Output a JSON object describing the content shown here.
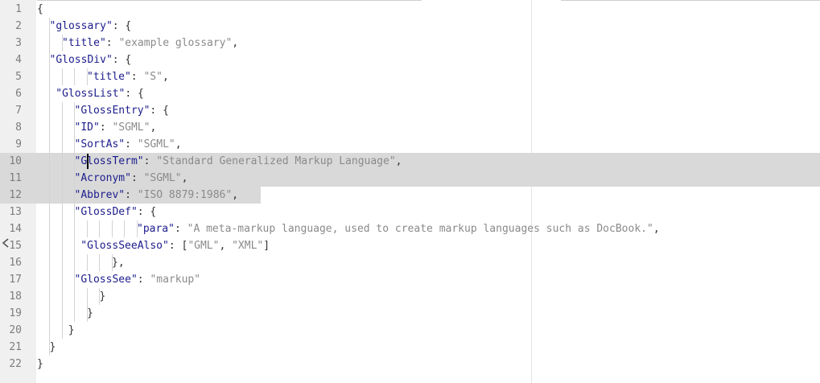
{
  "editor": {
    "lines": [
      {
        "n": "1",
        "indent": 0,
        "guides": 0,
        "tokens": [
          {
            "t": "{",
            "c": "p"
          }
        ]
      },
      {
        "n": "2",
        "indent": 1,
        "guides": 1,
        "tokens": [
          {
            "t": "\"glossary\"",
            "c": "k"
          },
          {
            "t": ": {",
            "c": "p"
          }
        ]
      },
      {
        "n": "3",
        "indent": 2,
        "guides": 2,
        "tokens": [
          {
            "t": "\"title\"",
            "c": "k"
          },
          {
            "t": ": ",
            "c": "p"
          },
          {
            "t": "\"example glossary\"",
            "c": "s"
          },
          {
            "t": ",",
            "c": "p"
          }
        ]
      },
      {
        "n": "4",
        "indent": 1,
        "guides": 1,
        "tokens": [
          {
            "t": "\"GlossDiv\"",
            "c": "k"
          },
          {
            "t": ": {",
            "c": "p"
          }
        ]
      },
      {
        "n": "5",
        "indent": 4,
        "guides": 4,
        "tokens": [
          {
            "t": "\"title\"",
            "c": "k"
          },
          {
            "t": ": ",
            "c": "p"
          },
          {
            "t": "\"S\"",
            "c": "s"
          },
          {
            "t": ",",
            "c": "p"
          }
        ]
      },
      {
        "n": "6",
        "indent": 1.5,
        "guides": 1,
        "tokens": [
          {
            "t": "\"GlossList\"",
            "c": "k"
          },
          {
            "t": ": {",
            "c": "p"
          }
        ]
      },
      {
        "n": "7",
        "indent": 3,
        "guides": 3,
        "tokens": [
          {
            "t": "\"GlossEntry\"",
            "c": "k"
          },
          {
            "t": ": {",
            "c": "p"
          }
        ]
      },
      {
        "n": "8",
        "indent": 3,
        "guides": 3,
        "tokens": [
          {
            "t": "\"ID\"",
            "c": "k"
          },
          {
            "t": ": ",
            "c": "p"
          },
          {
            "t": "\"SGML\"",
            "c": "s"
          },
          {
            "t": ",",
            "c": "p"
          }
        ]
      },
      {
        "n": "9",
        "indent": 3,
        "guides": 3,
        "tokens": [
          {
            "t": "\"SortAs\"",
            "c": "k"
          },
          {
            "t": ": ",
            "c": "p"
          },
          {
            "t": "\"SGML\"",
            "c": "s"
          },
          {
            "t": ",",
            "c": "p"
          }
        ]
      },
      {
        "n": "10",
        "indent": 3,
        "guides": 3,
        "tokens": [
          {
            "t": "\"GlossTerm\"",
            "c": "k"
          },
          {
            "t": ": ",
            "c": "p"
          },
          {
            "t": "\"Standard Generalized Markup Language\"",
            "c": "s"
          },
          {
            "t": ",",
            "c": "p"
          }
        ]
      },
      {
        "n": "11",
        "indent": 3,
        "guides": 3,
        "tokens": [
          {
            "t": "\"Acronym\"",
            "c": "k"
          },
          {
            "t": ": ",
            "c": "p"
          },
          {
            "t": "\"SGML\"",
            "c": "s"
          },
          {
            "t": ",",
            "c": "p"
          }
        ]
      },
      {
        "n": "12",
        "indent": 3,
        "guides": 3,
        "tokens": [
          {
            "t": "\"Abbrev\"",
            "c": "k"
          },
          {
            "t": ": ",
            "c": "p"
          },
          {
            "t": "\"ISO 8879:1986\"",
            "c": "s"
          },
          {
            "t": ",",
            "c": "p"
          }
        ]
      },
      {
        "n": "13",
        "indent": 3,
        "guides": 3,
        "tokens": [
          {
            "t": "\"GlossDef\"",
            "c": "k"
          },
          {
            "t": ": {",
            "c": "p"
          }
        ]
      },
      {
        "n": "14",
        "indent": 8,
        "guides": 8,
        "tokens": [
          {
            "t": "\"para\"",
            "c": "k"
          },
          {
            "t": ": ",
            "c": "p"
          },
          {
            "t": "\"A meta-markup language, used to create markup languages such as DocBook.\"",
            "c": "s"
          },
          {
            "t": ",",
            "c": "p"
          }
        ]
      },
      {
        "n": "15",
        "indent": 3.5,
        "guides": 3,
        "tokens": [
          {
            "t": "\"GlossSeeAlso\"",
            "c": "k"
          },
          {
            "t": ": [",
            "c": "p"
          },
          {
            "t": "\"GML\"",
            "c": "s"
          },
          {
            "t": ", ",
            "c": "p"
          },
          {
            "t": "\"XML\"",
            "c": "s"
          },
          {
            "t": "]",
            "c": "p"
          }
        ]
      },
      {
        "n": "16",
        "indent": 6,
        "guides": 6,
        "tokens": [
          {
            "t": "},",
            "c": "p"
          }
        ]
      },
      {
        "n": "17",
        "indent": 3,
        "guides": 3,
        "tokens": [
          {
            "t": "\"GlossSee\"",
            "c": "k"
          },
          {
            "t": ": ",
            "c": "p"
          },
          {
            "t": "\"markup\"",
            "c": "s"
          }
        ]
      },
      {
        "n": "18",
        "indent": 5,
        "guides": 5,
        "tokens": [
          {
            "t": "}",
            "c": "p"
          }
        ]
      },
      {
        "n": "19",
        "indent": 4,
        "guides": 4,
        "tokens": [
          {
            "t": "}",
            "c": "p"
          }
        ]
      },
      {
        "n": "20",
        "indent": 2.5,
        "guides": 2,
        "tokens": [
          {
            "t": "}",
            "c": "p"
          }
        ]
      },
      {
        "n": "21",
        "indent": 1,
        "guides": 1,
        "tokens": [
          {
            "t": "}",
            "c": "p"
          }
        ]
      },
      {
        "n": "22",
        "indent": 0,
        "guides": 0,
        "tokens": [
          {
            "t": "}",
            "c": "p"
          }
        ]
      }
    ],
    "selected_lines": [
      "10",
      "11",
      "12"
    ],
    "colors": {
      "key": "#1c1c8c",
      "string": "#8a8a8a",
      "punctuation": "#333333",
      "gutter_bg": "#f0f0f0",
      "line_number": "#7d7d7d",
      "selection": "#d9d9d9",
      "indent_guide": "#d3d3d3"
    },
    "collapse_icon": "chevron-left-icon"
  }
}
